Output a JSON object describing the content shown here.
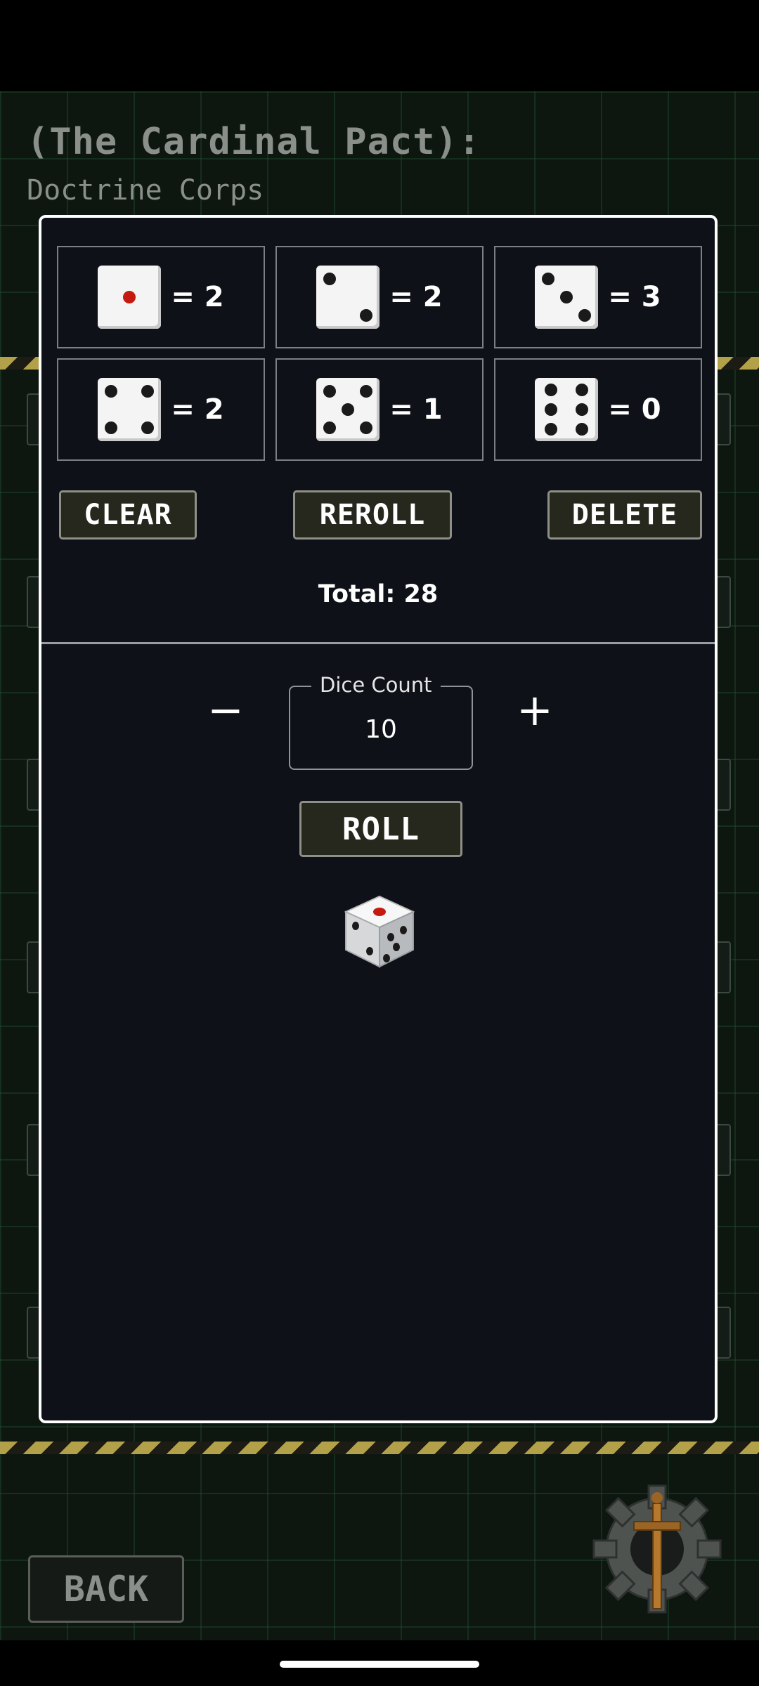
{
  "background": {
    "title": "(The Cardinal Pact):",
    "subtitle": "Doctrine Corps",
    "back_label": "BACK",
    "logo_icon": "gear-sword-icon"
  },
  "dialog": {
    "dice_results": [
      {
        "face": 1,
        "count_text": "= 2"
      },
      {
        "face": 2,
        "count_text": "= 2"
      },
      {
        "face": 3,
        "count_text": "= 3"
      },
      {
        "face": 4,
        "count_text": "= 2"
      },
      {
        "face": 5,
        "count_text": "= 1"
      },
      {
        "face": 6,
        "count_text": "= 0"
      }
    ],
    "buttons": {
      "clear": "CLEAR",
      "reroll": "REROLL",
      "delete": "DELETE",
      "roll": "ROLL"
    },
    "total_text": "Total: 28",
    "dice_count": {
      "label": "Dice Count",
      "value": "10",
      "decrement_symbol": "−",
      "increment_symbol": "+"
    },
    "roll_icon": "dice-3d-icon"
  },
  "colors": {
    "dialog_bg": "#0f1119",
    "button_bg": "#27281d",
    "pip_red": "#c41a10",
    "hazard_yellow": "#b3a14a"
  }
}
